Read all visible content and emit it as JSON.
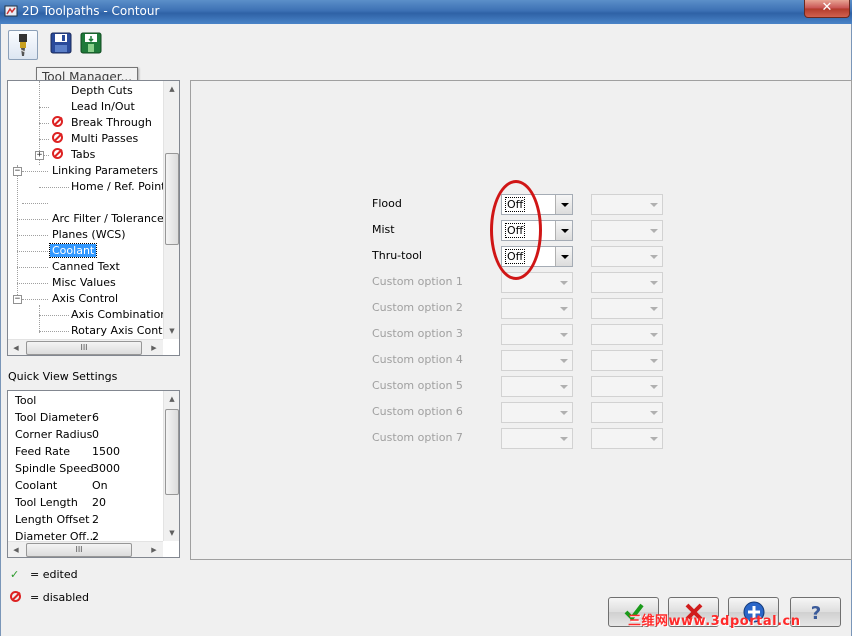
{
  "window": {
    "title": "2D Toolpaths - Contour",
    "close_label": "✕"
  },
  "toolbar": {
    "tooltip": "Tool Manager..."
  },
  "tree": {
    "items": [
      {
        "label": "Depth Cuts",
        "disabled": false
      },
      {
        "label": "Lead In/Out",
        "disabled": false
      },
      {
        "label": "Break Through",
        "disabled": true
      },
      {
        "label": "Multi Passes",
        "disabled": true
      },
      {
        "label": "Tabs",
        "disabled": true
      },
      {
        "label": "Linking Parameters",
        "disabled": false
      },
      {
        "label": "Home / Ref. Points",
        "disabled": false
      },
      {
        "label": "Arc Filter / Tolerance",
        "disabled": false
      },
      {
        "label": "Planes (WCS)",
        "disabled": false
      },
      {
        "label": "Coolant",
        "disabled": false,
        "selected": true
      },
      {
        "label": "Canned Text",
        "disabled": false
      },
      {
        "label": "Misc Values",
        "disabled": false
      },
      {
        "label": "Axis Control",
        "disabled": false
      },
      {
        "label": "Axis Combination",
        "disabled": false
      },
      {
        "label": "Rotary Axis Control",
        "disabled": false
      }
    ],
    "hscroll_grip": "III"
  },
  "quick_view": {
    "title": "Quick View Settings",
    "rows": [
      {
        "key": "Tool",
        "value": ""
      },
      {
        "key": "Tool Diameter",
        "value": "6"
      },
      {
        "key": "Corner Radius",
        "value": "0"
      },
      {
        "key": "Feed Rate",
        "value": "1500"
      },
      {
        "key": "Spindle Speed",
        "value": "3000"
      },
      {
        "key": "Coolant",
        "value": "On"
      },
      {
        "key": "Tool Length",
        "value": "20"
      },
      {
        "key": "Length Offset",
        "value": "2"
      },
      {
        "key": "Diameter Off...",
        "value": "2"
      }
    ],
    "hscroll_grip": "III"
  },
  "legend": {
    "edited_label": "= edited",
    "disabled_label": "= disabled"
  },
  "coolant": {
    "options": [
      {
        "label": "Flood",
        "value": "Off",
        "enabled": true
      },
      {
        "label": "Mist",
        "value": "Off",
        "enabled": true
      },
      {
        "label": "Thru-tool",
        "value": "Off",
        "enabled": true
      },
      {
        "label": "Custom option 1",
        "value": "",
        "enabled": false
      },
      {
        "label": "Custom option 2",
        "value": "",
        "enabled": false
      },
      {
        "label": "Custom option 3",
        "value": "",
        "enabled": false
      },
      {
        "label": "Custom option 4",
        "value": "",
        "enabled": false
      },
      {
        "label": "Custom option 5",
        "value": "",
        "enabled": false
      },
      {
        "label": "Custom option 6",
        "value": "",
        "enabled": false
      },
      {
        "label": "Custom option 7",
        "value": "",
        "enabled": false
      }
    ]
  },
  "watermark": "三维网www.3dportal.cn",
  "colors": {
    "accent": "#3399ff",
    "disabled_icon": "#dd2222",
    "annotation": "#d01616",
    "edited_check": "#2a9a2a"
  }
}
